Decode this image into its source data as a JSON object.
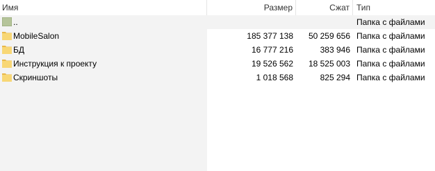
{
  "columns": {
    "name": "Имя",
    "size": "Размер",
    "packed": "Сжат",
    "type": "Тип"
  },
  "sort_indicator": "^",
  "rows": [
    {
      "name": "..",
      "size": "",
      "packed": "",
      "type": "Папка с файлами",
      "icon": "parent-folder-icon"
    },
    {
      "name": "MobileSalon",
      "size": "185 377 138",
      "packed": "50 259 656",
      "type": "Папка с файлами",
      "icon": "folder-icon"
    },
    {
      "name": "БД",
      "size": "16 777 216",
      "packed": "383 946",
      "type": "Папка с файлами",
      "icon": "folder-icon"
    },
    {
      "name": "Инструкция к проекту",
      "size": "19 526 562",
      "packed": "18 525 003",
      "type": "Папка с файлами",
      "icon": "folder-icon"
    },
    {
      "name": "Скриншоты",
      "size": "1 018 568",
      "packed": "825 294",
      "type": "Папка с файлами",
      "icon": "folder-icon"
    }
  ],
  "colors": {
    "folder": "#f8d775",
    "folder_dark": "#e8b84a",
    "parent_folder": "#b5c49a",
    "pane_bg": "#f3f3f3"
  }
}
